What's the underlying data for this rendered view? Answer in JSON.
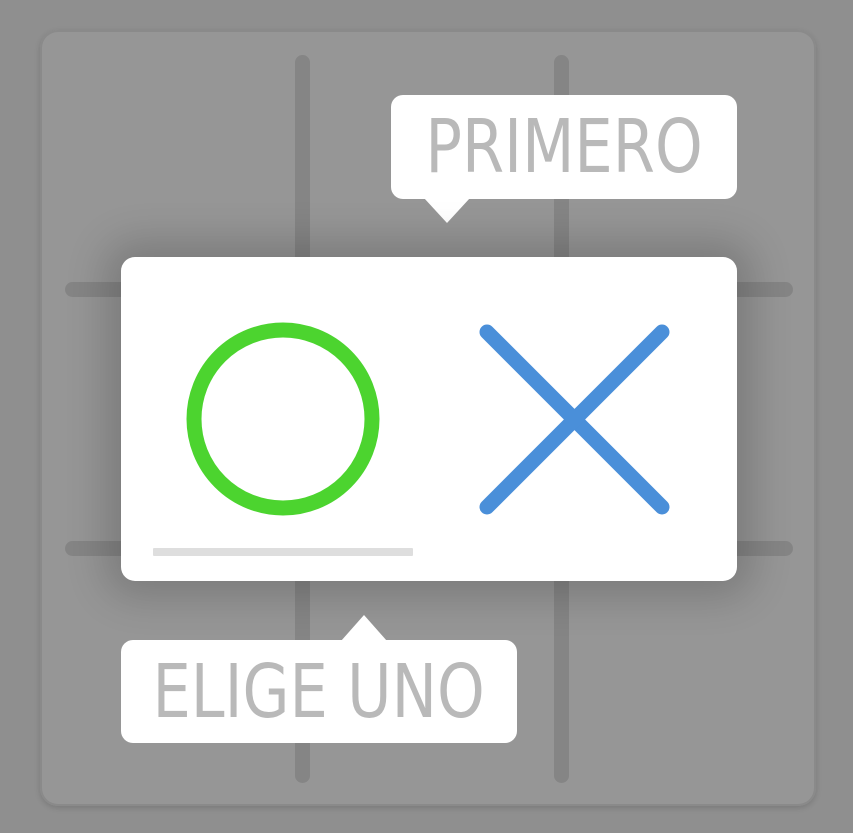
{
  "tooltips": {
    "first_label": "PRIMERO",
    "choose_label": "ELIGE UNO"
  },
  "choices": {
    "o": {
      "icon": "circle-o-icon",
      "color": "#4cd42f"
    },
    "x": {
      "icon": "cross-x-icon",
      "color": "#4a8fd9"
    }
  },
  "colors": {
    "background": "#8f8f8f",
    "board": "#969696",
    "grid_lines": "#858585",
    "dialog": "#ffffff",
    "tooltip_text": "#b9b9b9",
    "selection_bar": "#dedede"
  },
  "board": {
    "cells": [
      [
        "",
        "",
        ""
      ],
      [
        "",
        "",
        ""
      ],
      [
        "",
        "",
        ""
      ]
    ]
  }
}
